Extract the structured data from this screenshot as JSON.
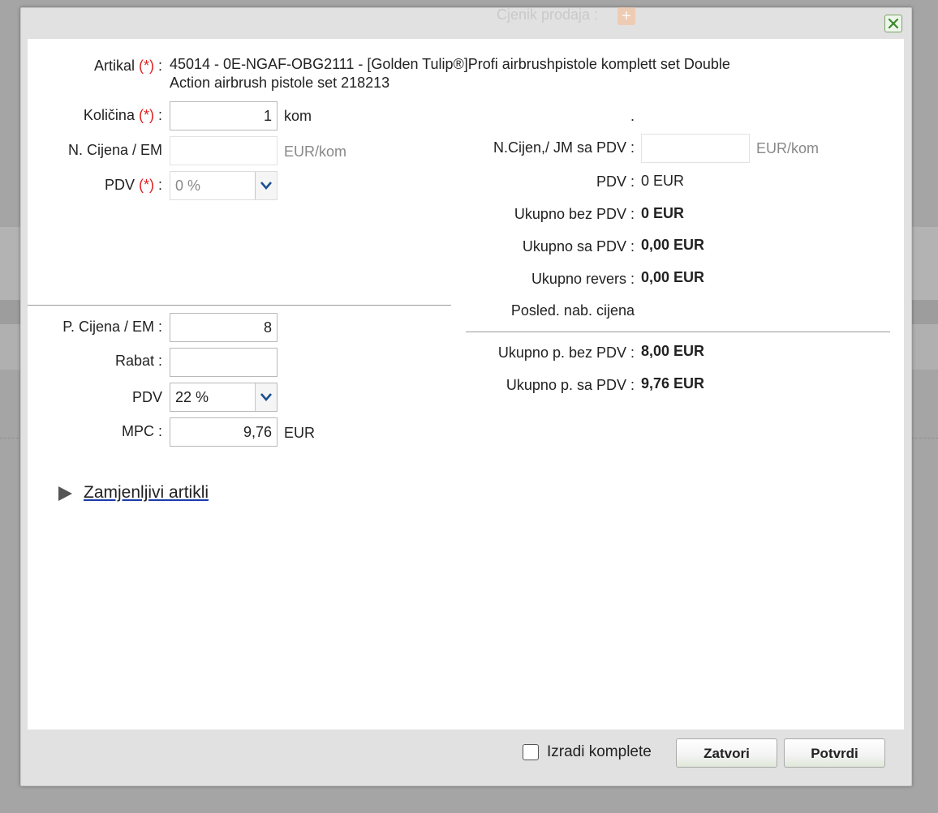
{
  "dialog": {
    "bg_title": "Cjenik prodaja :",
    "close_label": "×"
  },
  "left": {
    "artikal_label": "Artikal",
    "artikal_line1": "45014 - 0E-NGAF-OBG2111 - [Golden Tulip®]Profi airbrushpistole komplett set Double",
    "artikal_line2": "Action airbrush pistole set 218213",
    "required_marker": "(*)",
    "kolicina_label": "Količina",
    "kolicina_value": "1",
    "kolicina_unit": "kom",
    "n_cijena_label": "N. Cijena / EM",
    "n_cijena_value": "",
    "n_cijena_unit": "EUR/kom",
    "pdv_label": "PDV",
    "pdv_value": "0 %",
    "p_cijena_label": "P. Cijena / EM :",
    "p_cijena_value": "8",
    "rabat_label": "Rabat :",
    "rabat_value": "",
    "pdv2_label": "PDV",
    "pdv2_value": "22 %",
    "mpc_label": "MPC :",
    "mpc_value": "9,76",
    "mpc_unit": "EUR"
  },
  "right": {
    "dot": ".",
    "n_cijen_label": "N.Cijen,/ JM sa PDV :",
    "n_cijen_value": "",
    "n_cijen_unit": "EUR/kom",
    "pdv_label": "PDV :",
    "pdv_value": "0 EUR",
    "ukupno_bez_label": "Ukupno bez PDV :",
    "ukupno_bez_value": "0 EUR",
    "ukupno_sa_label": "Ukupno sa PDV :",
    "ukupno_sa_value": "0,00 EUR",
    "ukupno_revers_label": "Ukupno revers :",
    "ukupno_revers_value": "0,00 EUR",
    "posled_label": "Posled. nab. cijena",
    "ukupno_p_bez_label": "Ukupno p. bez PDV :",
    "ukupno_p_bez_value": "8,00 EUR",
    "ukupno_p_sa_label": "Ukupno p. sa PDV :",
    "ukupno_p_sa_value": "9,76 EUR"
  },
  "expander": {
    "label": "Zamjenljivi artikli"
  },
  "footer": {
    "checkbox_label": "Izradi komplete",
    "close_button": "Zatvori",
    "confirm_button": "Potvrdi"
  },
  "colors": {
    "required": "#e02020",
    "close_icon": "#3a8a2a"
  }
}
